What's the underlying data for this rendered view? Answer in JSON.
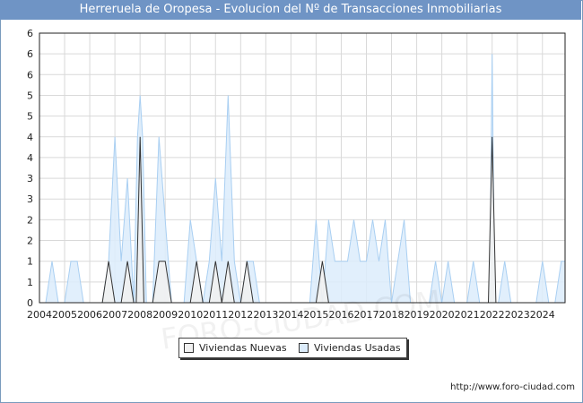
{
  "title": "Herreruela de Oropesa - Evolucion del Nº de Transacciones Inmobiliarias",
  "source": "http://www.foro-ciudad.com",
  "watermark": "FORO-CIUDAD.COM",
  "colors": {
    "title_bg": "#6f94c5",
    "nuevas_fill": "#f1f1f1",
    "nuevas_line": "#333333",
    "usadas_fill": "#dcecfb",
    "usadas_line": "#a9cff2"
  },
  "chart_data": {
    "type": "area",
    "xlabel": "",
    "ylabel": "",
    "x_range": [
      2004,
      2024.9
    ],
    "ylim": [
      0,
      6.5
    ],
    "y_ticks": [
      {
        "value": 0,
        "label": "0"
      },
      {
        "value": 0.5,
        "label": "1"
      },
      {
        "value": 1,
        "label": "1"
      },
      {
        "value": 1.5,
        "label": "2"
      },
      {
        "value": 2,
        "label": "2"
      },
      {
        "value": 2.5,
        "label": "3"
      },
      {
        "value": 3,
        "label": "3"
      },
      {
        "value": 3.5,
        "label": "4"
      },
      {
        "value": 4,
        "label": "4"
      },
      {
        "value": 4.5,
        "label": "5"
      },
      {
        "value": 5,
        "label": "5"
      },
      {
        "value": 5.5,
        "label": "6"
      },
      {
        "value": 6,
        "label": "6"
      },
      {
        "value": 6.5,
        "label": "6"
      }
    ],
    "x_ticks": [
      "2004",
      "2005",
      "2006",
      "2007",
      "2008",
      "2009",
      "2010",
      "2011",
      "2012",
      "2013",
      "2014",
      "2015",
      "2016",
      "2017",
      "2018",
      "2019",
      "2020",
      "2021",
      "2022",
      "2023",
      "2024"
    ],
    "grid": true,
    "legend_position": "bottom",
    "series": [
      {
        "name": "Viviendas Nuevas",
        "points": [
          [
            2004.0,
            0
          ],
          [
            2006.5,
            0
          ],
          [
            2006.75,
            1
          ],
          [
            2007.0,
            0
          ],
          [
            2007.25,
            0
          ],
          [
            2007.5,
            1
          ],
          [
            2007.75,
            0
          ],
          [
            2007.85,
            0
          ],
          [
            2008.0,
            4
          ],
          [
            2008.15,
            0
          ],
          [
            2008.5,
            0
          ],
          [
            2008.75,
            1
          ],
          [
            2009.0,
            1
          ],
          [
            2009.25,
            0
          ],
          [
            2010.0,
            0
          ],
          [
            2010.25,
            1
          ],
          [
            2010.5,
            0
          ],
          [
            2010.75,
            0
          ],
          [
            2011.0,
            1
          ],
          [
            2011.25,
            0
          ],
          [
            2011.5,
            1
          ],
          [
            2011.75,
            0
          ],
          [
            2012.0,
            0
          ],
          [
            2012.25,
            1
          ],
          [
            2012.5,
            0
          ],
          [
            2015.0,
            0
          ],
          [
            2015.25,
            1
          ],
          [
            2015.5,
            0
          ],
          [
            2021.75,
            0
          ],
          [
            2021.85,
            0
          ],
          [
            2022.0,
            4
          ],
          [
            2022.15,
            0
          ],
          [
            2024.9,
            0
          ]
        ]
      },
      {
        "name": "Viviendas Usadas",
        "points": [
          [
            2004.0,
            0
          ],
          [
            2004.25,
            0
          ],
          [
            2004.5,
            1
          ],
          [
            2004.75,
            0
          ],
          [
            2005.0,
            0
          ],
          [
            2005.25,
            1
          ],
          [
            2005.5,
            1
          ],
          [
            2005.75,
            0
          ],
          [
            2006.25,
            0
          ],
          [
            2006.5,
            0
          ],
          [
            2006.75,
            1
          ],
          [
            2007.0,
            4
          ],
          [
            2007.25,
            1
          ],
          [
            2007.5,
            3
          ],
          [
            2007.75,
            0
          ],
          [
            2007.9,
            4
          ],
          [
            2008.0,
            5
          ],
          [
            2008.1,
            4
          ],
          [
            2008.25,
            0
          ],
          [
            2008.5,
            0
          ],
          [
            2008.75,
            4
          ],
          [
            2009.0,
            2
          ],
          [
            2009.25,
            0
          ],
          [
            2009.5,
            0
          ],
          [
            2009.75,
            0
          ],
          [
            2010.0,
            2
          ],
          [
            2010.25,
            1
          ],
          [
            2010.5,
            0
          ],
          [
            2010.75,
            1
          ],
          [
            2011.0,
            3
          ],
          [
            2011.25,
            1
          ],
          [
            2011.5,
            5
          ],
          [
            2011.75,
            1
          ],
          [
            2012.0,
            0
          ],
          [
            2012.25,
            1
          ],
          [
            2012.5,
            1
          ],
          [
            2012.75,
            0
          ],
          [
            2014.5,
            0
          ],
          [
            2014.75,
            0
          ],
          [
            2015.0,
            2
          ],
          [
            2015.25,
            0
          ],
          [
            2015.5,
            2
          ],
          [
            2015.75,
            1
          ],
          [
            2016.0,
            1
          ],
          [
            2016.25,
            1
          ],
          [
            2016.5,
            2
          ],
          [
            2016.75,
            1
          ],
          [
            2017.0,
            1
          ],
          [
            2017.25,
            2
          ],
          [
            2017.5,
            1
          ],
          [
            2017.75,
            2
          ],
          [
            2018.0,
            0
          ],
          [
            2018.25,
            1
          ],
          [
            2018.5,
            2
          ],
          [
            2018.75,
            0
          ],
          [
            2019.25,
            0
          ],
          [
            2019.5,
            0
          ],
          [
            2019.75,
            1
          ],
          [
            2020.0,
            0
          ],
          [
            2020.25,
            1
          ],
          [
            2020.5,
            0
          ],
          [
            2020.75,
            0
          ],
          [
            2021.0,
            0
          ],
          [
            2021.25,
            1
          ],
          [
            2021.5,
            0
          ],
          [
            2021.75,
            0
          ],
          [
            2021.9,
            0
          ],
          [
            2022.0,
            6
          ],
          [
            2022.1,
            0
          ],
          [
            2022.25,
            0
          ],
          [
            2022.5,
            1
          ],
          [
            2022.75,
            0
          ],
          [
            2023.5,
            0
          ],
          [
            2023.75,
            0
          ],
          [
            2024.0,
            1
          ],
          [
            2024.25,
            0
          ],
          [
            2024.5,
            0
          ],
          [
            2024.75,
            1
          ],
          [
            2024.9,
            1
          ]
        ]
      }
    ]
  }
}
